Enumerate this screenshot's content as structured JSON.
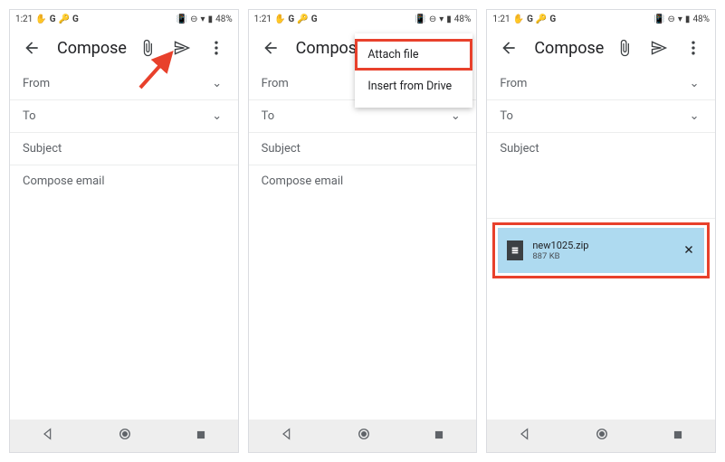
{
  "status": {
    "time": "1:21",
    "battery_pct": "48%"
  },
  "appbar": {
    "title": "Compose"
  },
  "fields": {
    "from": "From",
    "to": "To",
    "subject": "Subject",
    "body_placeholder": "Compose email"
  },
  "menu": {
    "attach_file": "Attach file",
    "insert_drive": "Insert from Drive"
  },
  "attachment": {
    "name": "new1025.zip",
    "size": "887 KB"
  }
}
